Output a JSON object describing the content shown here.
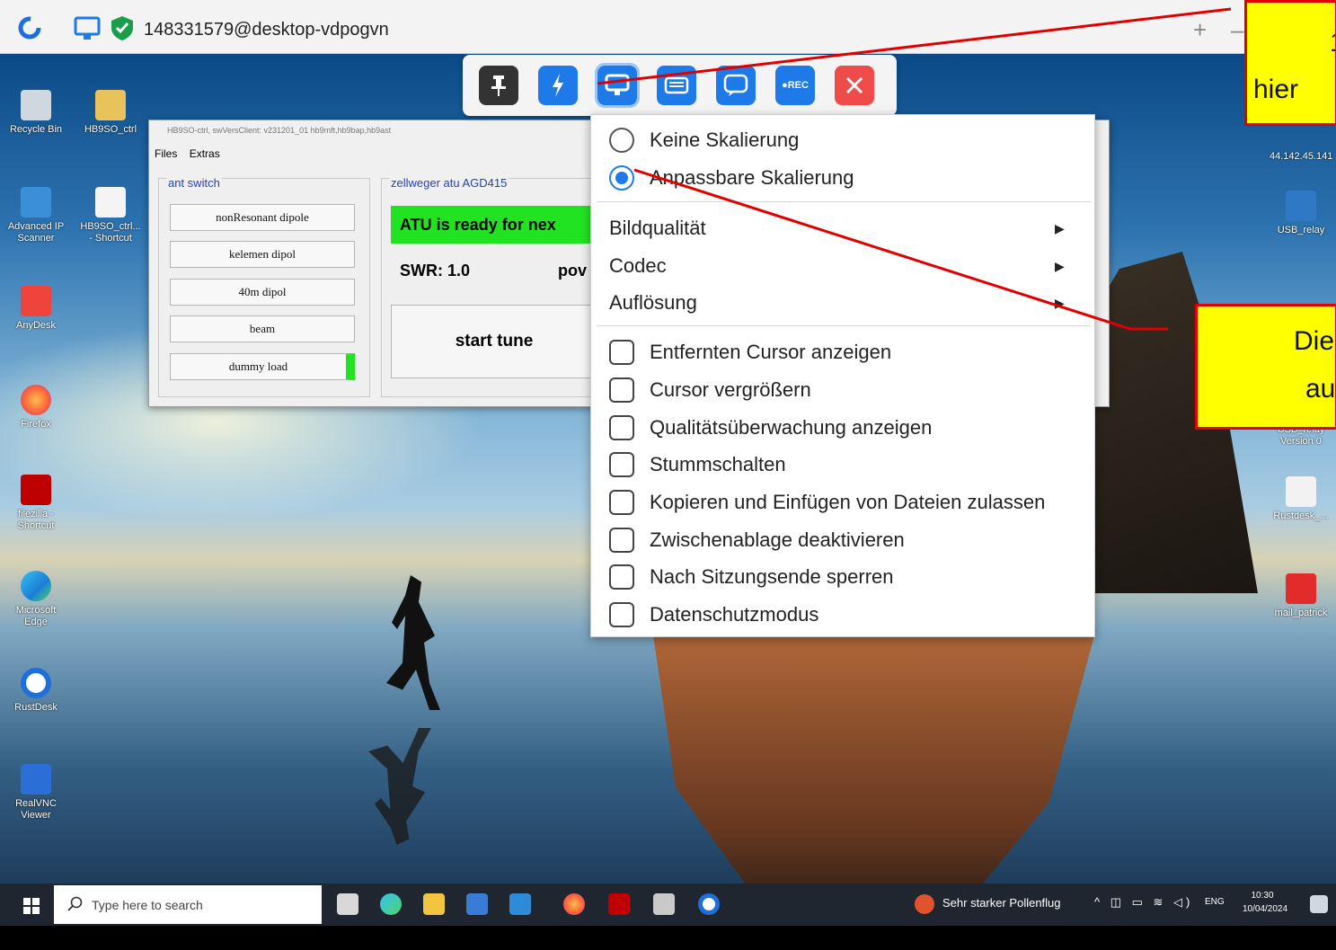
{
  "window": {
    "title": "148331579@desktop-vdpogvn",
    "plus": "+",
    "minimize": "–"
  },
  "desktop_icons": {
    "left": [
      {
        "label": "Recycle Bin"
      },
      {
        "label": "HB9SO_ctrl"
      },
      {
        "label": "Advanced IP Scanner"
      },
      {
        "label": "HB9SO_ctrl... - Shortcut"
      },
      {
        "label": "AnyDesk"
      },
      {
        "label": "Firefox"
      },
      {
        "label": "filezilla - Shortcut"
      },
      {
        "label": "Microsoft Edge"
      },
      {
        "label": "RustDesk"
      },
      {
        "label": "RealVNC Viewer"
      }
    ],
    "right": [
      {
        "label": "44.142.45.141"
      },
      {
        "label": "USB_relay"
      },
      {
        "label": "USB_relay Version 0"
      },
      {
        "label": "Rustdesk_..."
      },
      {
        "label": "mail_patrick"
      }
    ]
  },
  "app": {
    "title": "HB9SO-ctrl, swVersClient: v231201_01     hb9mft,hb9bap,hb9ast",
    "menu": [
      "Files",
      "Extras"
    ],
    "ant_switch": {
      "title": "ant switch",
      "buttons": [
        "nonResonant dipole",
        "kelemen dipol",
        "40m dipol",
        "beam",
        "dummy load"
      ]
    },
    "atu": {
      "title": "zellweger atu AGD415",
      "status": "ATU is ready for nex",
      "swr": "SWR: 1.0",
      "pow": "pov",
      "tune": "start tune"
    }
  },
  "toolbar": {
    "pin": "pin-icon",
    "lightning": "lightning-icon",
    "display": "display-icon",
    "keyboard": "keyboard-icon",
    "chat": "chat-icon",
    "rec": "●REC",
    "close": "close-icon"
  },
  "menu": {
    "scaling": [
      {
        "label": "Keine Skalierung",
        "selected": false
      },
      {
        "label": "Anpassbare Skalierung",
        "selected": true
      }
    ],
    "submenus": [
      "Bildqualität",
      "Codec",
      "Auflösung"
    ],
    "checkboxes": [
      "Entfernten Cursor anzeigen",
      "Cursor vergrößern",
      "Qualitätsüberwachung anzeigen",
      "Stummschalten",
      "Kopieren und Einfügen von Dateien zulassen",
      "Zwischenablage deaktivieren",
      "Nach Sitzungsende sperren",
      "Datenschutzmodus"
    ]
  },
  "annotations": {
    "box1_line1": "1",
    "box1_line2": "hier",
    "box2_line1": "Die",
    "box2_line2": "au"
  },
  "taskbar": {
    "search_placeholder": "Type here to search",
    "weather": "Sehr starker Pollenflug",
    "lang": "ENG",
    "time": "10:30",
    "date": "10/04/2024"
  }
}
